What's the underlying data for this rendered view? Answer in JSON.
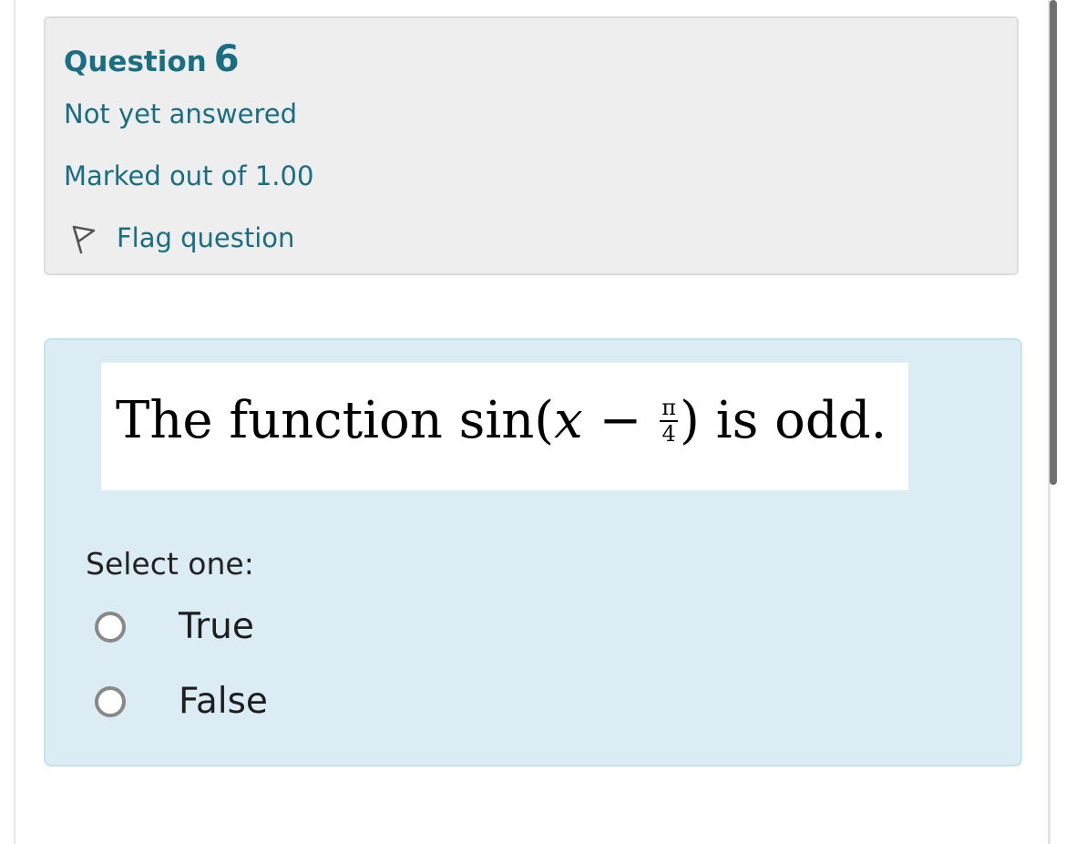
{
  "question": {
    "label": "Question",
    "number": "6",
    "status": "Not yet answered",
    "marks": "Marked out of 1.00",
    "flag_label": "Flag question"
  },
  "question_text": {
    "before": "The function sin(",
    "variable": "x",
    "minus": " − ",
    "frac_numerator": "π",
    "frac_denominator": "4",
    "after": ") is odd."
  },
  "answer": {
    "prompt": "Select one:",
    "options": [
      {
        "label": "True",
        "selected": false
      },
      {
        "label": "False",
        "selected": false
      }
    ]
  },
  "colors": {
    "accent": "#1a6e83",
    "info_bg": "#eeeeee",
    "content_bg": "#dbecf5"
  },
  "icons": {
    "flag": "flag-icon"
  }
}
